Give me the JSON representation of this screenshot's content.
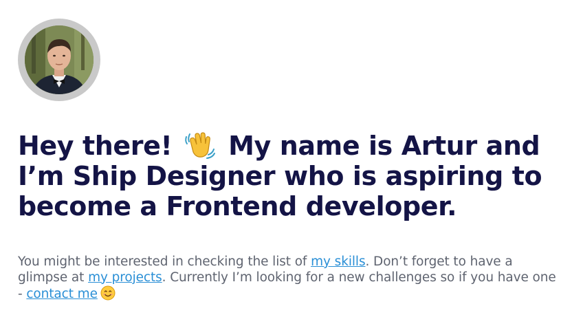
{
  "profile": {
    "avatar_alt": "Artur"
  },
  "headline": {
    "part1": "Hey there!",
    "wave_icon": "waving-hand-icon",
    "part2": "My name is Artur and I’m Ship Designer who is aspiring to become a Frontend developer."
  },
  "intro": {
    "text1": "You might be interested in checking the list of ",
    "link_skills": "my skills",
    "text2": ". Don’t forget to have a glimpse at ",
    "link_projects": "my projects",
    "text3": ". Currently I’m looking for a new challenges so if you have one - ",
    "link_contact": "contact me",
    "smile_icon": "smiling-face-icon"
  },
  "colors": {
    "heading": "#141446",
    "body_text": "#5f6470",
    "link": "#2a8fd6",
    "avatar_ring": "#c9c9c9"
  }
}
